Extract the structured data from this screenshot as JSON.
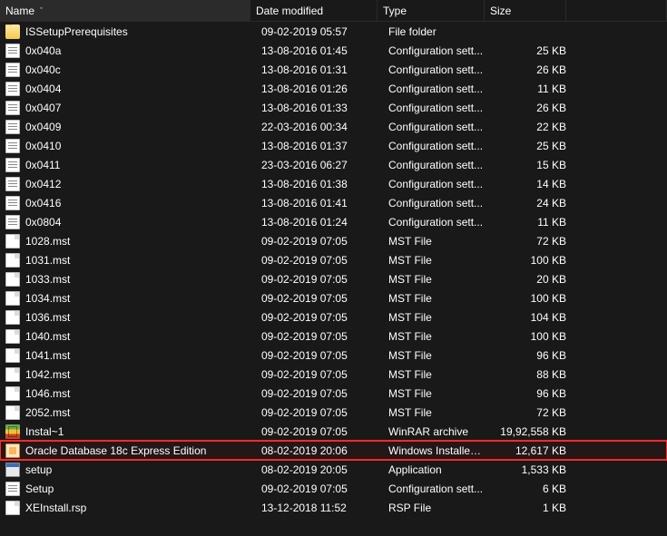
{
  "columns": {
    "name": "Name",
    "date": "Date modified",
    "type": "Type",
    "size": "Size",
    "sort_indicator": "ˇ"
  },
  "icon_types": {
    "folder": "folder-icon",
    "cfg": "config-file-icon",
    "mst": "mst-file-icon",
    "rar": "winrar-archive-icon",
    "msi": "msi-installer-icon",
    "exe": "application-icon",
    "rsp": "rsp-file-icon"
  },
  "rows": [
    {
      "icon": "folder",
      "name": "ISSetupPrerequisites",
      "date": "09-02-2019 05:57",
      "type": "File folder",
      "size": "",
      "hl": false
    },
    {
      "icon": "cfg",
      "name": "0x040a",
      "date": "13-08-2016 01:45",
      "type": "Configuration sett...",
      "size": "25 KB",
      "hl": false
    },
    {
      "icon": "cfg",
      "name": "0x040c",
      "date": "13-08-2016 01:31",
      "type": "Configuration sett...",
      "size": "26 KB",
      "hl": false
    },
    {
      "icon": "cfg",
      "name": "0x0404",
      "date": "13-08-2016 01:26",
      "type": "Configuration sett...",
      "size": "11 KB",
      "hl": false
    },
    {
      "icon": "cfg",
      "name": "0x0407",
      "date": "13-08-2016 01:33",
      "type": "Configuration sett...",
      "size": "26 KB",
      "hl": false
    },
    {
      "icon": "cfg",
      "name": "0x0409",
      "date": "22-03-2016 00:34",
      "type": "Configuration sett...",
      "size": "22 KB",
      "hl": false
    },
    {
      "icon": "cfg",
      "name": "0x0410",
      "date": "13-08-2016 01:37",
      "type": "Configuration sett...",
      "size": "25 KB",
      "hl": false
    },
    {
      "icon": "cfg",
      "name": "0x0411",
      "date": "23-03-2016 06:27",
      "type": "Configuration sett...",
      "size": "15 KB",
      "hl": false
    },
    {
      "icon": "cfg",
      "name": "0x0412",
      "date": "13-08-2016 01:38",
      "type": "Configuration sett...",
      "size": "14 KB",
      "hl": false
    },
    {
      "icon": "cfg",
      "name": "0x0416",
      "date": "13-08-2016 01:41",
      "type": "Configuration sett...",
      "size": "24 KB",
      "hl": false
    },
    {
      "icon": "cfg",
      "name": "0x0804",
      "date": "13-08-2016 01:24",
      "type": "Configuration sett...",
      "size": "11 KB",
      "hl": false
    },
    {
      "icon": "mst",
      "name": "1028.mst",
      "date": "09-02-2019 07:05",
      "type": "MST File",
      "size": "72 KB",
      "hl": false
    },
    {
      "icon": "mst",
      "name": "1031.mst",
      "date": "09-02-2019 07:05",
      "type": "MST File",
      "size": "100 KB",
      "hl": false
    },
    {
      "icon": "mst",
      "name": "1033.mst",
      "date": "09-02-2019 07:05",
      "type": "MST File",
      "size": "20 KB",
      "hl": false
    },
    {
      "icon": "mst",
      "name": "1034.mst",
      "date": "09-02-2019 07:05",
      "type": "MST File",
      "size": "100 KB",
      "hl": false
    },
    {
      "icon": "mst",
      "name": "1036.mst",
      "date": "09-02-2019 07:05",
      "type": "MST File",
      "size": "104 KB",
      "hl": false
    },
    {
      "icon": "mst",
      "name": "1040.mst",
      "date": "09-02-2019 07:05",
      "type": "MST File",
      "size": "100 KB",
      "hl": false
    },
    {
      "icon": "mst",
      "name": "1041.mst",
      "date": "09-02-2019 07:05",
      "type": "MST File",
      "size": "96 KB",
      "hl": false
    },
    {
      "icon": "mst",
      "name": "1042.mst",
      "date": "09-02-2019 07:05",
      "type": "MST File",
      "size": "88 KB",
      "hl": false
    },
    {
      "icon": "mst",
      "name": "1046.mst",
      "date": "09-02-2019 07:05",
      "type": "MST File",
      "size": "96 KB",
      "hl": false
    },
    {
      "icon": "mst",
      "name": "2052.mst",
      "date": "09-02-2019 07:05",
      "type": "MST File",
      "size": "72 KB",
      "hl": false
    },
    {
      "icon": "rar",
      "name": "Instal~1",
      "date": "09-02-2019 07:05",
      "type": "WinRAR archive",
      "size": "19,92,558 KB",
      "hl": false
    },
    {
      "icon": "msi",
      "name": "Oracle Database 18c Express Edition",
      "date": "08-02-2019 20:06",
      "type": "Windows Installer ...",
      "size": "12,617 KB",
      "hl": true
    },
    {
      "icon": "exe",
      "name": "setup",
      "date": "08-02-2019 20:05",
      "type": "Application",
      "size": "1,533 KB",
      "hl": false
    },
    {
      "icon": "cfg",
      "name": "Setup",
      "date": "09-02-2019 07:05",
      "type": "Configuration sett...",
      "size": "6 KB",
      "hl": false
    },
    {
      "icon": "rsp",
      "name": "XEInstall.rsp",
      "date": "13-12-2018 11:52",
      "type": "RSP File",
      "size": "1 KB",
      "hl": false
    }
  ]
}
